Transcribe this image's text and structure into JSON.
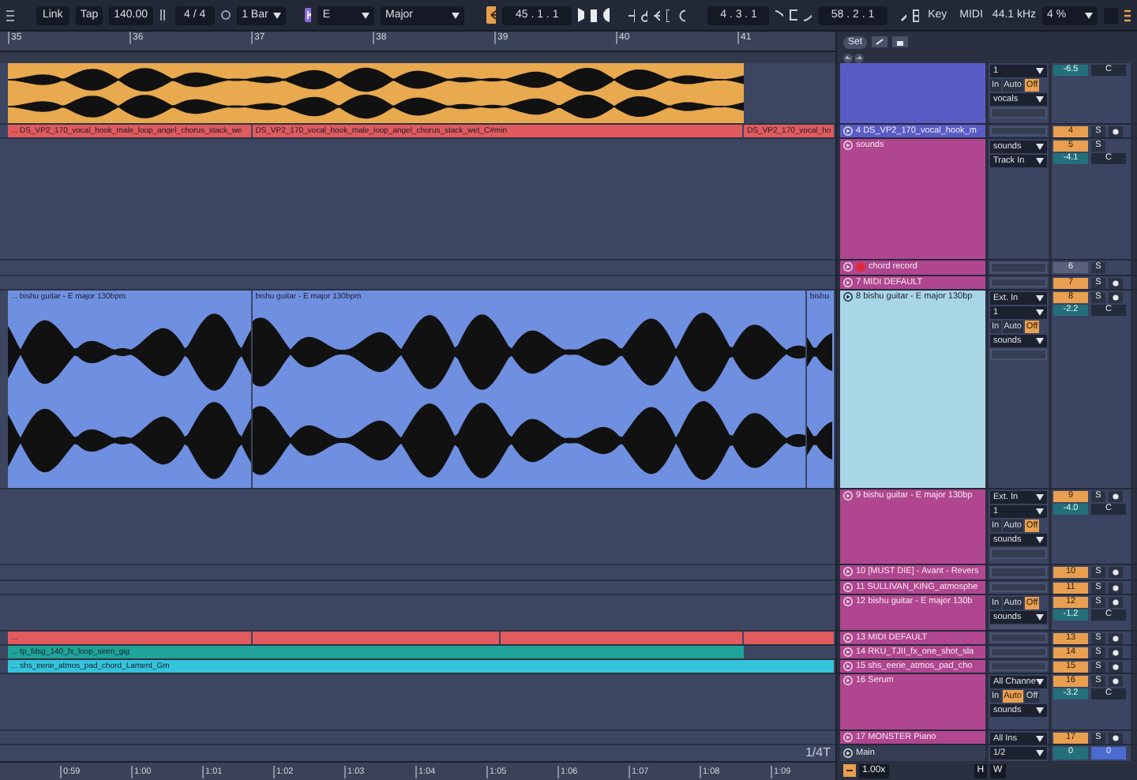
{
  "transport": {
    "link": "Link",
    "tap": "Tap",
    "tempo": "140.00",
    "signature": "4 / 4",
    "quantize": "1 Bar",
    "key": "E",
    "scale": "Major",
    "position": "45 . 1 . 1",
    "loop_start": "4 . 3 . 1",
    "loop_length": "58 . 2 . 1",
    "key_button": "Key",
    "midi_button": "MIDI",
    "sample_rate": "44.1 kHz",
    "cpu": "4 %"
  },
  "ruler": {
    "bars": [
      "35",
      "36",
      "37",
      "38",
      "39",
      "40",
      "41"
    ],
    "set": "Set"
  },
  "tracks": [
    {
      "color": "#5a5cc6",
      "armed": false,
      "volume": "-6.5",
      "pan": "C",
      "io": [
        {
          "kind": "select",
          "value": "1"
        },
        {
          "kind": "monitor",
          "options": [
            {
              "label": "In",
              "selected": false
            },
            {
              "label": "Auto",
              "selected": false
            },
            {
              "label": "Off",
              "selected": true
            }
          ]
        },
        {
          "kind": "select",
          "value": "vocals"
        },
        {
          "kind": "blank"
        }
      ],
      "clips": [
        {
          "color": "#e8a94f",
          "waveform": true
        }
      ]
    },
    {
      "name": "4 DS_VP2_170_vocal_hook_m",
      "color": "#5a5cc6",
      "armed": false,
      "number": "4",
      "active": true,
      "solo": "S",
      "arm": true,
      "io": [
        {
          "kind": "blank"
        }
      ],
      "clips": [
        {
          "label": "... DS_VP2_170_vocal_hook_male_loop_angel_chorus_stack_we",
          "color": "#e05a5e"
        },
        {
          "label": "DS_VP2_170_vocal_hook_male_loop_angel_chorus_stack_wet_C#min",
          "color": "#e05a5e"
        },
        {
          "label": "DS_VP2_170_vocal_ho",
          "color": "#e05a5e"
        }
      ]
    },
    {
      "name": "sounds",
      "color": "#b0468f",
      "armed": false,
      "number": "5",
      "active": true,
      "solo": "S",
      "arm": false,
      "volume": "-4.1",
      "pan": "C",
      "io": [
        {
          "kind": "select",
          "value": "sounds"
        },
        {
          "kind": "select",
          "value": "Track In"
        }
      ]
    },
    {
      "name": "chord record",
      "color": "#b0468f",
      "armed": true,
      "number": "6",
      "active": false,
      "solo": "S",
      "arm": false,
      "io": [
        {
          "kind": "blank"
        }
      ]
    },
    {
      "name": "7 MIDI DEFAULT",
      "color": "#b0468f",
      "armed": false,
      "number": "7",
      "active": true,
      "solo": "S",
      "arm": true,
      "io": [
        {
          "kind": "blank"
        }
      ]
    },
    {
      "name": "8 bishu guitar - E major 130bp",
      "color": "#a9d6e6",
      "armed": false,
      "number": "8",
      "active": true,
      "solo": "S",
      "arm": true,
      "volume": "-2.2",
      "pan": "C",
      "io": [
        {
          "kind": "select",
          "value": "Ext. In"
        },
        {
          "kind": "select",
          "value": "1"
        },
        {
          "kind": "monitor",
          "options": [
            {
              "label": "In",
              "selected": false
            },
            {
              "label": "Auto",
              "selected": false
            },
            {
              "label": "Off",
              "selected": true
            }
          ]
        },
        {
          "kind": "select",
          "value": "sounds"
        },
        {
          "kind": "blank"
        }
      ],
      "clips": [
        {
          "label": "... bishu guitar - E major 130bpm",
          "color": "#6f8fe0",
          "waveform": true
        },
        {
          "label": "bishu guitar - E major 130bpm",
          "color": "#6f8fe0",
          "waveform": true
        },
        {
          "label": "bishu",
          "color": "#6f8fe0",
          "waveform": true
        }
      ]
    },
    {
      "name": "9 bishu guitar - E major 130bp",
      "color": "#b0468f",
      "armed": false,
      "number": "9",
      "active": true,
      "solo": "S",
      "arm": true,
      "volume": "-4.0",
      "pan": "C",
      "io": [
        {
          "kind": "select",
          "value": "Ext. In"
        },
        {
          "kind": "select",
          "value": "1"
        },
        {
          "kind": "monitor",
          "options": [
            {
              "label": "In",
              "selected": false
            },
            {
              "label": "Auto",
              "selected": false
            },
            {
              "label": "Off",
              "selected": true
            }
          ]
        },
        {
          "kind": "select",
          "value": "sounds"
        },
        {
          "kind": "blank"
        }
      ]
    },
    {
      "name": "10 [MUST DIE] - Avant - Revers",
      "color": "#b0468f",
      "armed": false,
      "number": "10",
      "active": true,
      "solo": "S",
      "arm": true,
      "io": [
        {
          "kind": "blank"
        }
      ]
    },
    {
      "name": "11 SULLIVAN_KING_atmosphe",
      "color": "#b0468f",
      "armed": false,
      "number": "11",
      "active": true,
      "solo": "S",
      "arm": true,
      "io": [
        {
          "kind": "blank"
        }
      ]
    },
    {
      "name": "12 bishu guitar - E major 130b",
      "color": "#b0468f",
      "armed": false,
      "number": "12",
      "active": true,
      "solo": "S",
      "arm": true,
      "volume": "-1.2",
      "pan": "C",
      "io": [
        {
          "kind": "monitor",
          "options": [
            {
              "label": "In",
              "selected": false
            },
            {
              "label": "Auto",
              "selected": false
            },
            {
              "label": "Off",
              "selected": true
            }
          ]
        },
        {
          "kind": "select",
          "value": "sounds"
        },
        {
          "kind": "blank"
        }
      ]
    },
    {
      "name": "13 MIDI DEFAULT",
      "color": "#b0468f",
      "armed": false,
      "number": "13",
      "active": true,
      "solo": "S",
      "arm": true,
      "io": [
        {
          "kind": "blank"
        }
      ],
      "clips": [
        {
          "label": "...",
          "color": "#e05a5e"
        },
        {
          "color": "#e05a5e"
        },
        {
          "color": "#e05a5e"
        },
        {
          "color": "#e05a5e"
        }
      ]
    },
    {
      "name": "14 RKU_TJII_fx_one_shot_sla",
      "color": "#b0468f",
      "armed": false,
      "number": "14",
      "active": true,
      "solo": "S",
      "arm": true,
      "io": [
        {
          "kind": "blank"
        }
      ],
      "clips": [
        {
          "label": "... tp_fdsg_140_fx_loop_siren_gig",
          "color": "#1fa39a"
        }
      ]
    },
    {
      "name": "15 shs_eerie_atmos_pad_cho",
      "color": "#b0468f",
      "armed": false,
      "number": "15",
      "active": true,
      "solo": "S",
      "arm": true,
      "io": [
        {
          "kind": "blank"
        }
      ],
      "clips": [
        {
          "label": "... shs_eerie_atmos_pad_chord_Lament_Gm",
          "color": "#34c3dc"
        }
      ]
    },
    {
      "name": "16 Serum",
      "color": "#b0468f",
      "armed": false,
      "number": "16",
      "active": true,
      "solo": "S",
      "arm": true,
      "volume": "-3.2",
      "pan": "C",
      "io": [
        {
          "kind": "select",
          "value": "All Channe"
        },
        {
          "kind": "monitor",
          "options": [
            {
              "label": "In",
              "selected": false
            },
            {
              "label": "Auto",
              "selected": true
            },
            {
              "label": "Off",
              "selected": false
            }
          ]
        },
        {
          "kind": "select",
          "value": "sounds"
        }
      ]
    },
    {
      "name": "17 MONSTER Piano",
      "color": "#b0468f",
      "armed": false,
      "number": "17",
      "active": true,
      "solo": "S",
      "arm": true,
      "io": [
        {
          "kind": "select",
          "value": "All Ins"
        }
      ]
    }
  ],
  "main": {
    "name": "Main",
    "output": "1/2",
    "volume": "0",
    "pan": "0"
  },
  "footer": {
    "grid": "1/4T",
    "times": [
      "0:59",
      "1:00",
      "1:01",
      "1:02",
      "1:03",
      "1:04",
      "1:05",
      "1:06",
      "1:07",
      "1:08",
      "1:09"
    ],
    "zoom": "1.00x",
    "buttons": [
      "H",
      "W"
    ]
  }
}
